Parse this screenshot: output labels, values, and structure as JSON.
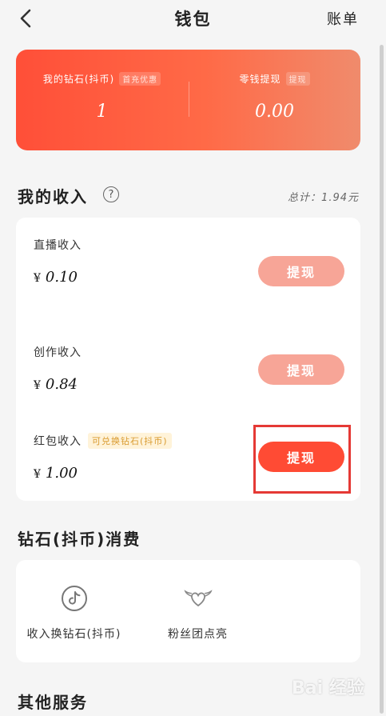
{
  "header": {
    "title": "钱包",
    "right_link": "账单"
  },
  "wallet": {
    "diamond_label": "我的钻石(抖币)",
    "diamond_tag": "首充优惠",
    "diamond_value": "1",
    "change_label": "零钱提现",
    "change_tag": "提现",
    "change_value": "0.00",
    "colors": {
      "gradient_start": "#ff4f38",
      "gradient_end": "#f08b6c"
    }
  },
  "income": {
    "title": "我的收入",
    "help_icon": "question-circle-icon",
    "total": "总计：1.94元",
    "items": [
      {
        "label": "直播收入",
        "currency": "¥",
        "amount": "0.10",
        "button": "提现",
        "state": "disabled"
      },
      {
        "label": "创作收入",
        "currency": "¥",
        "amount": "0.84",
        "button": "提现",
        "state": "disabled"
      },
      {
        "label": "红包收入",
        "badge": "可兑换钻石(抖币)",
        "currency": "¥",
        "amount": "1.00",
        "button": "提现",
        "state": "active"
      }
    ]
  },
  "diamond_spend": {
    "title": "钻石(抖币)消费",
    "items": [
      {
        "label": "收入换钻石(抖币)",
        "icon": "douyin-logo-icon"
      },
      {
        "label": "粉丝团点亮",
        "icon": "winged-heart-icon"
      }
    ]
  },
  "other_services": {
    "title": "其他服务"
  },
  "watermark": "Bai 经验"
}
